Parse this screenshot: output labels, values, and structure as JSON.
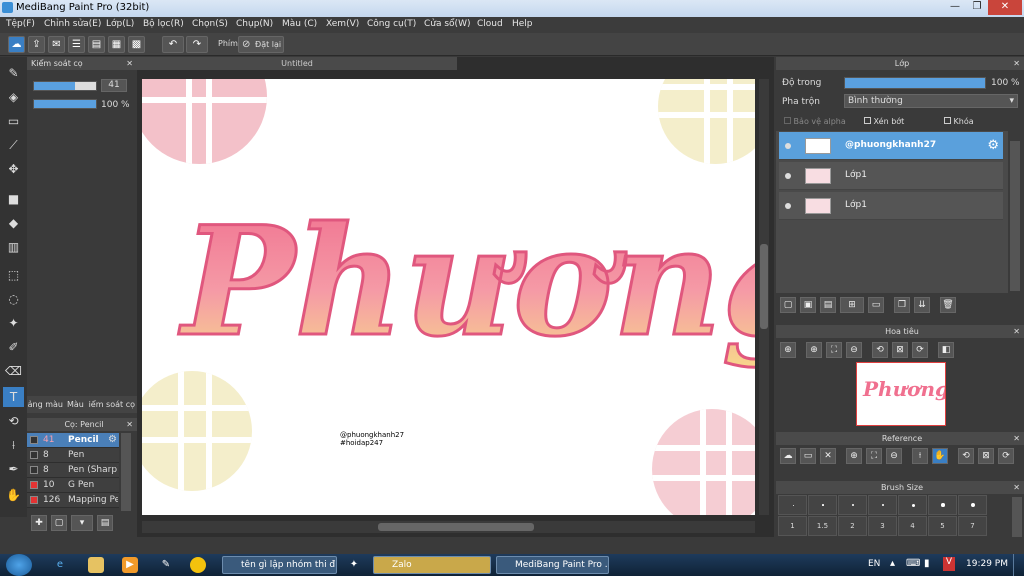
{
  "window": {
    "title": "MediBang Paint Pro (32bit)"
  },
  "menu": [
    "Tệp(F)",
    "Chỉnh sửa(E)",
    "Lớp(L)",
    "Bộ lọc(R)",
    "Chọn(S)",
    "Chụp(N)",
    "Màu (C)",
    "Xem(V)",
    "Công cụ(T)",
    "Cửa sổ(W)",
    "Cloud",
    "Help"
  ],
  "toolbar": {
    "phim_label": "Phím",
    "reset_label": "Đặt lại"
  },
  "brush_control": {
    "title": "Kiểm soát cọ",
    "size": "41",
    "opacity": "100 %"
  },
  "panel_tabs": [
    "Bảng màu",
    "Màu",
    "Kiểm soát cọ"
  ],
  "brush_list": {
    "title": "Cọ: Pencil",
    "items": [
      {
        "size": "41",
        "name": "Pencil",
        "color": "#333333",
        "selected": true
      },
      {
        "size": "8",
        "name": "Pen",
        "color": "#333333"
      },
      {
        "size": "8",
        "name": "Pen (Sharp)",
        "color": "#333333"
      },
      {
        "size": "10",
        "name": "G Pen",
        "color": "#e33333"
      },
      {
        "size": "126",
        "name": "Mapping Pen",
        "color": "#e33333"
      }
    ]
  },
  "canvas": {
    "tab": "Untitled",
    "lettering": "Phương",
    "credit1": "@phuongkhanh27",
    "credit2": "#hoidap247"
  },
  "layers": {
    "title": "Lớp",
    "opacity_label": "Độ trong",
    "opacity_value": "100 %",
    "opacity_fraction": 1.0,
    "blend_label": "Pha trộn",
    "blend_value": "Bình thường",
    "protect_alpha": "Bảo vệ alpha",
    "clipping": "Xén bớt",
    "lock": "Khóa",
    "rows": [
      {
        "name": "@phuongkhanh27",
        "selected": true
      },
      {
        "name": "Lớp1"
      },
      {
        "name": "Lớp1"
      }
    ]
  },
  "navigator": {
    "title": "Hoa tiêu",
    "preview_text": "Phương"
  },
  "reference": {
    "title": "Reference"
  },
  "brush_size": {
    "title": "Brush Size",
    "values": [
      "1",
      "1.5",
      "2",
      "3",
      "4",
      "5",
      "7"
    ]
  },
  "taskbar": {
    "tasks": [
      "tên gì lập nhóm thi đ...",
      "Zalo",
      "MediBang Paint Pro ..."
    ],
    "lang": "EN",
    "clock": "19:29 PM"
  },
  "colors": {
    "accent": "#5aa0dc",
    "pink": "#f07a9a",
    "yellow": "#f7d98a"
  }
}
